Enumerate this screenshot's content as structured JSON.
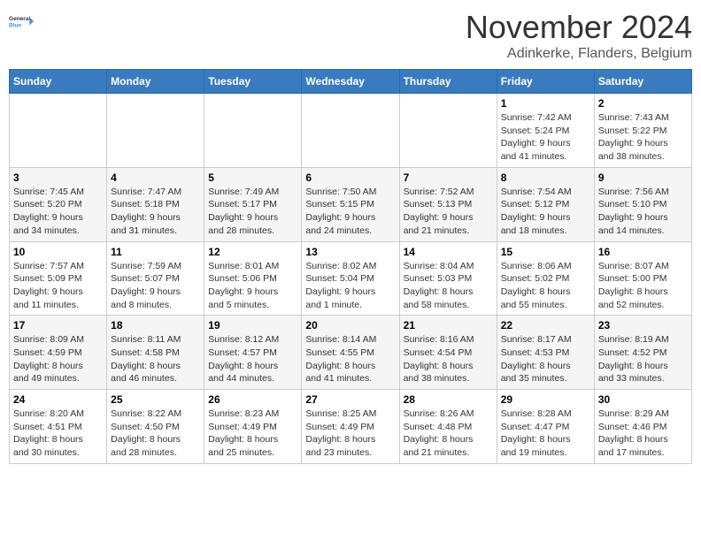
{
  "logo": {
    "line1": "General",
    "line2": "Blue"
  },
  "title": "November 2024",
  "location": "Adinkerke, Flanders, Belgium",
  "days_of_week": [
    "Sunday",
    "Monday",
    "Tuesday",
    "Wednesday",
    "Thursday",
    "Friday",
    "Saturday"
  ],
  "weeks": [
    [
      {
        "day": "",
        "info": ""
      },
      {
        "day": "",
        "info": ""
      },
      {
        "day": "",
        "info": ""
      },
      {
        "day": "",
        "info": ""
      },
      {
        "day": "",
        "info": ""
      },
      {
        "day": "1",
        "info": "Sunrise: 7:42 AM\nSunset: 5:24 PM\nDaylight: 9 hours\nand 41 minutes."
      },
      {
        "day": "2",
        "info": "Sunrise: 7:43 AM\nSunset: 5:22 PM\nDaylight: 9 hours\nand 38 minutes."
      }
    ],
    [
      {
        "day": "3",
        "info": "Sunrise: 7:45 AM\nSunset: 5:20 PM\nDaylight: 9 hours\nand 34 minutes."
      },
      {
        "day": "4",
        "info": "Sunrise: 7:47 AM\nSunset: 5:18 PM\nDaylight: 9 hours\nand 31 minutes."
      },
      {
        "day": "5",
        "info": "Sunrise: 7:49 AM\nSunset: 5:17 PM\nDaylight: 9 hours\nand 28 minutes."
      },
      {
        "day": "6",
        "info": "Sunrise: 7:50 AM\nSunset: 5:15 PM\nDaylight: 9 hours\nand 24 minutes."
      },
      {
        "day": "7",
        "info": "Sunrise: 7:52 AM\nSunset: 5:13 PM\nDaylight: 9 hours\nand 21 minutes."
      },
      {
        "day": "8",
        "info": "Sunrise: 7:54 AM\nSunset: 5:12 PM\nDaylight: 9 hours\nand 18 minutes."
      },
      {
        "day": "9",
        "info": "Sunrise: 7:56 AM\nSunset: 5:10 PM\nDaylight: 9 hours\nand 14 minutes."
      }
    ],
    [
      {
        "day": "10",
        "info": "Sunrise: 7:57 AM\nSunset: 5:09 PM\nDaylight: 9 hours\nand 11 minutes."
      },
      {
        "day": "11",
        "info": "Sunrise: 7:59 AM\nSunset: 5:07 PM\nDaylight: 9 hours\nand 8 minutes."
      },
      {
        "day": "12",
        "info": "Sunrise: 8:01 AM\nSunset: 5:06 PM\nDaylight: 9 hours\nand 5 minutes."
      },
      {
        "day": "13",
        "info": "Sunrise: 8:02 AM\nSunset: 5:04 PM\nDaylight: 9 hours\nand 1 minute."
      },
      {
        "day": "14",
        "info": "Sunrise: 8:04 AM\nSunset: 5:03 PM\nDaylight: 8 hours\nand 58 minutes."
      },
      {
        "day": "15",
        "info": "Sunrise: 8:06 AM\nSunset: 5:02 PM\nDaylight: 8 hours\nand 55 minutes."
      },
      {
        "day": "16",
        "info": "Sunrise: 8:07 AM\nSunset: 5:00 PM\nDaylight: 8 hours\nand 52 minutes."
      }
    ],
    [
      {
        "day": "17",
        "info": "Sunrise: 8:09 AM\nSunset: 4:59 PM\nDaylight: 8 hours\nand 49 minutes."
      },
      {
        "day": "18",
        "info": "Sunrise: 8:11 AM\nSunset: 4:58 PM\nDaylight: 8 hours\nand 46 minutes."
      },
      {
        "day": "19",
        "info": "Sunrise: 8:12 AM\nSunset: 4:57 PM\nDaylight: 8 hours\nand 44 minutes."
      },
      {
        "day": "20",
        "info": "Sunrise: 8:14 AM\nSunset: 4:55 PM\nDaylight: 8 hours\nand 41 minutes."
      },
      {
        "day": "21",
        "info": "Sunrise: 8:16 AM\nSunset: 4:54 PM\nDaylight: 8 hours\nand 38 minutes."
      },
      {
        "day": "22",
        "info": "Sunrise: 8:17 AM\nSunset: 4:53 PM\nDaylight: 8 hours\nand 35 minutes."
      },
      {
        "day": "23",
        "info": "Sunrise: 8:19 AM\nSunset: 4:52 PM\nDaylight: 8 hours\nand 33 minutes."
      }
    ],
    [
      {
        "day": "24",
        "info": "Sunrise: 8:20 AM\nSunset: 4:51 PM\nDaylight: 8 hours\nand 30 minutes."
      },
      {
        "day": "25",
        "info": "Sunrise: 8:22 AM\nSunset: 4:50 PM\nDaylight: 8 hours\nand 28 minutes."
      },
      {
        "day": "26",
        "info": "Sunrise: 8:23 AM\nSunset: 4:49 PM\nDaylight: 8 hours\nand 25 minutes."
      },
      {
        "day": "27",
        "info": "Sunrise: 8:25 AM\nSunset: 4:49 PM\nDaylight: 8 hours\nand 23 minutes."
      },
      {
        "day": "28",
        "info": "Sunrise: 8:26 AM\nSunset: 4:48 PM\nDaylight: 8 hours\nand 21 minutes."
      },
      {
        "day": "29",
        "info": "Sunrise: 8:28 AM\nSunset: 4:47 PM\nDaylight: 8 hours\nand 19 minutes."
      },
      {
        "day": "30",
        "info": "Sunrise: 8:29 AM\nSunset: 4:46 PM\nDaylight: 8 hours\nand 17 minutes."
      }
    ]
  ]
}
